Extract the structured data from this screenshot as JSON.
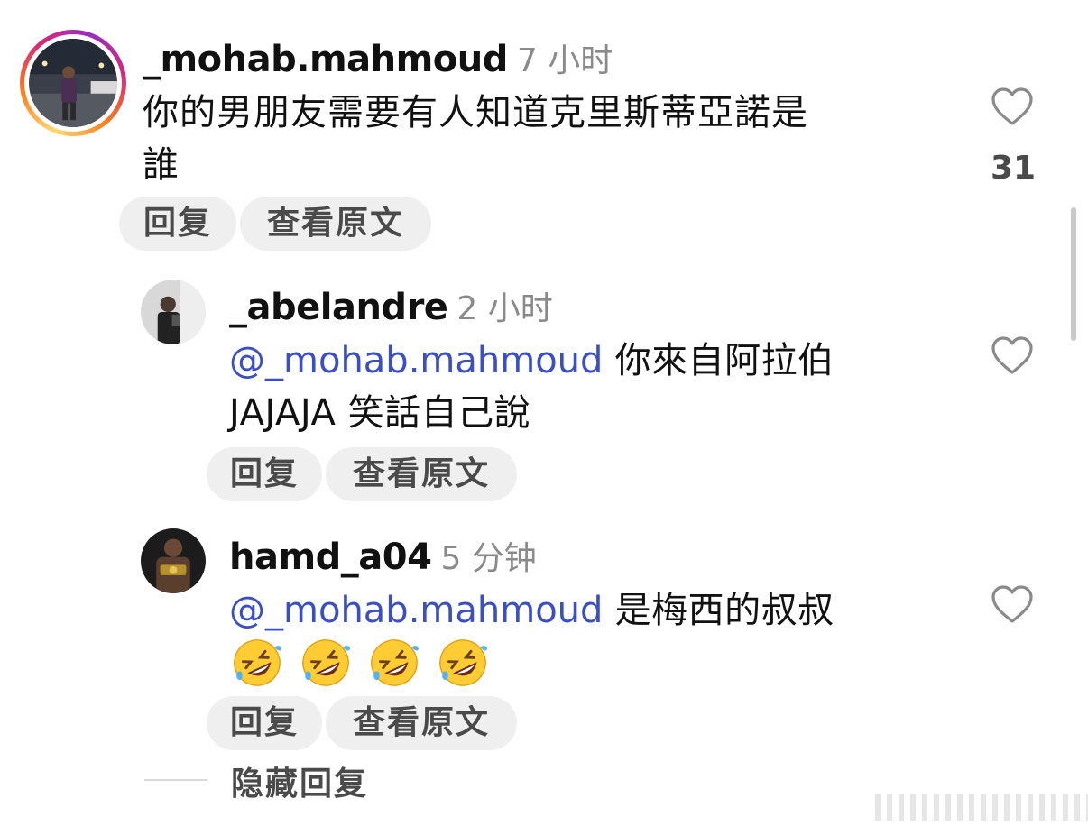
{
  "comments": [
    {
      "username": "_mohab.mahmoud",
      "time": "7 小时",
      "text_line1": "你的男朋友需要有人知道克里斯蒂亞諾是",
      "text_line2": "誰",
      "like_count": "31",
      "reply_label": "回复",
      "translate_label": "查看原文"
    },
    {
      "username": "_abelandre",
      "time": "2 小时",
      "mention": "@_mohab.mahmoud",
      "text_line1": "你來自阿拉伯",
      "text_line2": "JAJAJA 笑話自己說",
      "reply_label": "回复",
      "translate_label": "查看原文"
    },
    {
      "username": "hamd_a04",
      "time": "5 分钟",
      "mention": "@_mohab.mahmoud",
      "text_line1": "是梅西的叔叔",
      "emojis": [
        "rolling-on-floor-laughing",
        "rolling-on-floor-laughing",
        "rolling-on-floor-laughing",
        "rolling-on-floor-laughing"
      ],
      "reply_label": "回复",
      "translate_label": "查看原文"
    }
  ],
  "hide_replies_label": "隐藏回复",
  "colors": {
    "mention": "#3a4fc4",
    "pill_bg": "#efefef",
    "secondary_text": "#8a8a8a"
  }
}
